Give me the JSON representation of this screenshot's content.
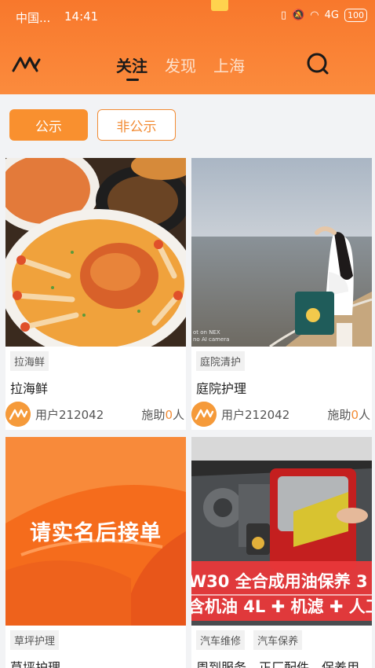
{
  "status": {
    "carrier": "中国...",
    "time": "14:41",
    "wifi_label": "4G",
    "battery": "100"
  },
  "nav": {
    "tabs": [
      "关注",
      "发现",
      "上海"
    ]
  },
  "filters": [
    "公示",
    "非公示"
  ],
  "cards": [
    {
      "tags": [
        "拉海鲜"
      ],
      "title": "拉海鲜",
      "user": "用户212042",
      "help_prefix": "施助",
      "help_count": "0",
      "help_suffix": "人"
    },
    {
      "tags": [
        "庭院清护"
      ],
      "title": "庭院护理",
      "user": "用户212042",
      "help_prefix": "施助",
      "help_count": "0",
      "help_suffix": "人",
      "watermark": "ot on NEX\nno AI camera"
    },
    {
      "tags": [
        "草坪护理"
      ],
      "title": "草坪护理",
      "banner_text": "请实名后接单"
    },
    {
      "tags": [
        "汽车维修",
        "汽车保养"
      ],
      "title": "周到服务、正厂配件、保养用",
      "banner_line1": "W30 全合成用油保养 3",
      "banner_line2": "含机油 4L ✚ 机滤 ✚ 人工"
    }
  ],
  "colors": {
    "accent": "#f9902f",
    "header": "#f8782c"
  }
}
